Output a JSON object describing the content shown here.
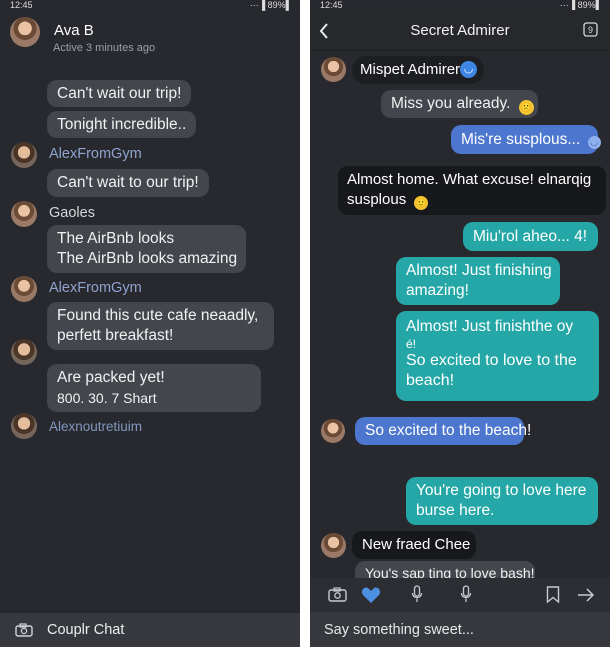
{
  "status": {
    "time": "12:45",
    "system": "···▐ 89%▌"
  },
  "left": {
    "contact_name": "Ava B",
    "contact_status": "Active 3 minutes ago",
    "messages": [
      {
        "text": "Can't wait our trip!"
      },
      {
        "text": "Tonight incredible.."
      },
      {
        "sender": "AlexFromGym",
        "text": "Can't wait to our trip!"
      },
      {
        "sender": "Gaoles",
        "lines": [
          "The AirBnb looks",
          "The AirBnb looks amazing"
        ]
      },
      {
        "sender": "AlexFromGym",
        "lines": [
          "Found this cute cafe neaadly,",
          "perfett breakfast!"
        ]
      },
      {
        "lines": [
          "Are packed yet!",
          "800. 30. 7 Shart"
        ]
      },
      {
        "sender": "Alexnoutretiuim"
      }
    ],
    "footer_label": "Couplr Chat",
    "footer_icon": "camera-icon"
  },
  "right": {
    "header_title": "Secret Admirer",
    "back_icon": "chevron-left-icon",
    "info_icon": "info-square-icon",
    "messages": [
      {
        "sender": "Mispet Admirer",
        "sender_badge": "◡"
      },
      {
        "text": "Miss you already.",
        "emoji": "😕"
      },
      {
        "text": "Mis're susplous...",
        "emoji": "◡"
      },
      {
        "lines": [
          "Almost home. What excuse! elnarqig",
          "susplous"
        ],
        "emoji": "🙂"
      },
      {
        "text": "Miu'rol aheo... 4!"
      },
      {
        "lines": [
          "Almost! Just finishing",
          "amazing!"
        ]
      },
      {
        "lines": [
          "Almost! Just finishthe oy",
          "é!",
          "So excited to love to the",
          "beach!"
        ]
      },
      {
        "text": "So excited to the beach!"
      },
      {
        "lines": [
          "You're going to love here",
          "burse here."
        ]
      },
      {
        "text": "New fraed Chee"
      },
      {
        "text": "You's sap ting to love bash!"
      }
    ],
    "toolbar_icons": [
      "camera-icon",
      "heart-icon",
      "microphone-icon",
      "microphone-icon",
      "bookmark-icon",
      "send-arrow-icon"
    ],
    "input_placeholder": "Say something sweet..."
  },
  "colors": {
    "background": "#27292e",
    "incoming_bubble": "#43464c",
    "blue_bubble": "#4d76cf",
    "teal_bubble": "#24a7a6",
    "sender_name": "#8fa3cf",
    "footer": "#36383d"
  }
}
